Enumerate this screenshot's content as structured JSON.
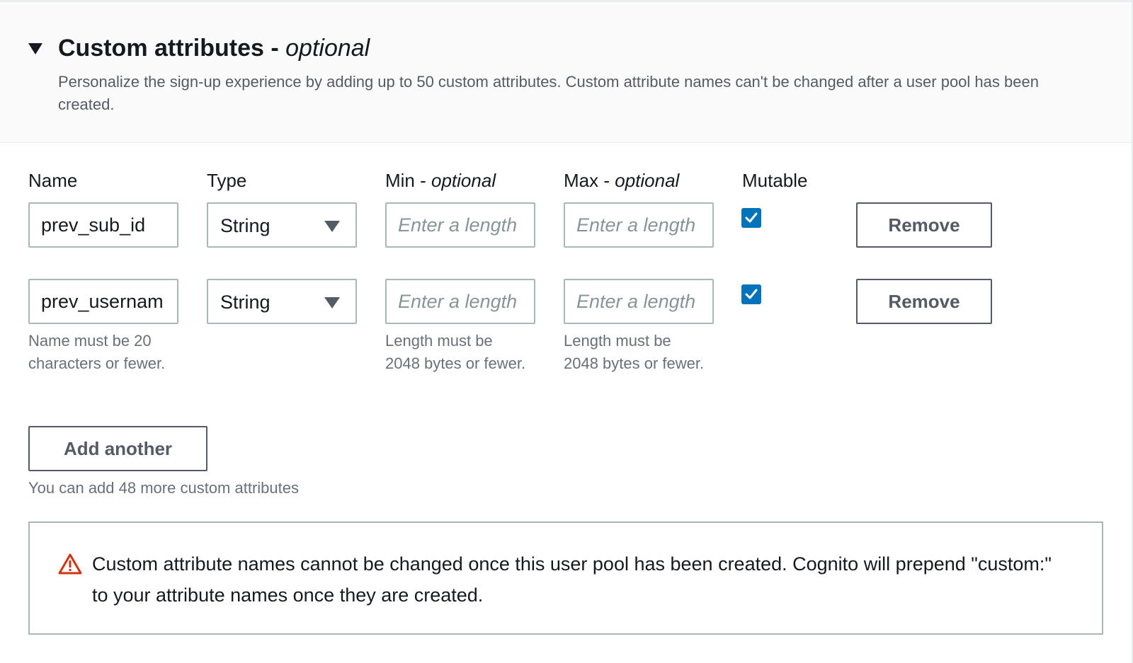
{
  "section": {
    "title": "Custom attributes",
    "title_separator": " - ",
    "title_optional": "optional",
    "description": "Personalize the sign-up experience by adding up to 50 custom attributes. Custom attribute names can't be changed after a user pool has been created."
  },
  "columns": {
    "name": "Name",
    "type": "Type",
    "min": "Min",
    "max": "Max",
    "optional_suffix": "optional",
    "separator": " - ",
    "mutable": "Mutable"
  },
  "rows": [
    {
      "name_value": "prev_sub_id",
      "type_value": "String",
      "min_placeholder": "Enter a length",
      "max_placeholder": "Enter a length",
      "mutable_checked": true,
      "remove_label": "Remove"
    },
    {
      "name_value": "prev_usernam",
      "type_value": "String",
      "min_placeholder": "Enter a length",
      "max_placeholder": "Enter a length",
      "mutable_checked": true,
      "remove_label": "Remove"
    }
  ],
  "help": {
    "name": "Name must be 20 characters or fewer.",
    "min": "Length must be 2048 bytes or fewer.",
    "max": "Length must be 2048 bytes or fewer."
  },
  "add_button_label": "Add another",
  "counter_text": "You can add 48 more custom attributes",
  "alert": {
    "icon": "warning-triangle-icon",
    "text": "Custom attribute names cannot be changed once this user pool has been created. Cognito will prepend \"custom:\" to your attribute names once they are created."
  },
  "colors": {
    "accent": "#0073bb",
    "warning": "#d13212",
    "border": "#aab7b8",
    "text_secondary": "#687078"
  }
}
